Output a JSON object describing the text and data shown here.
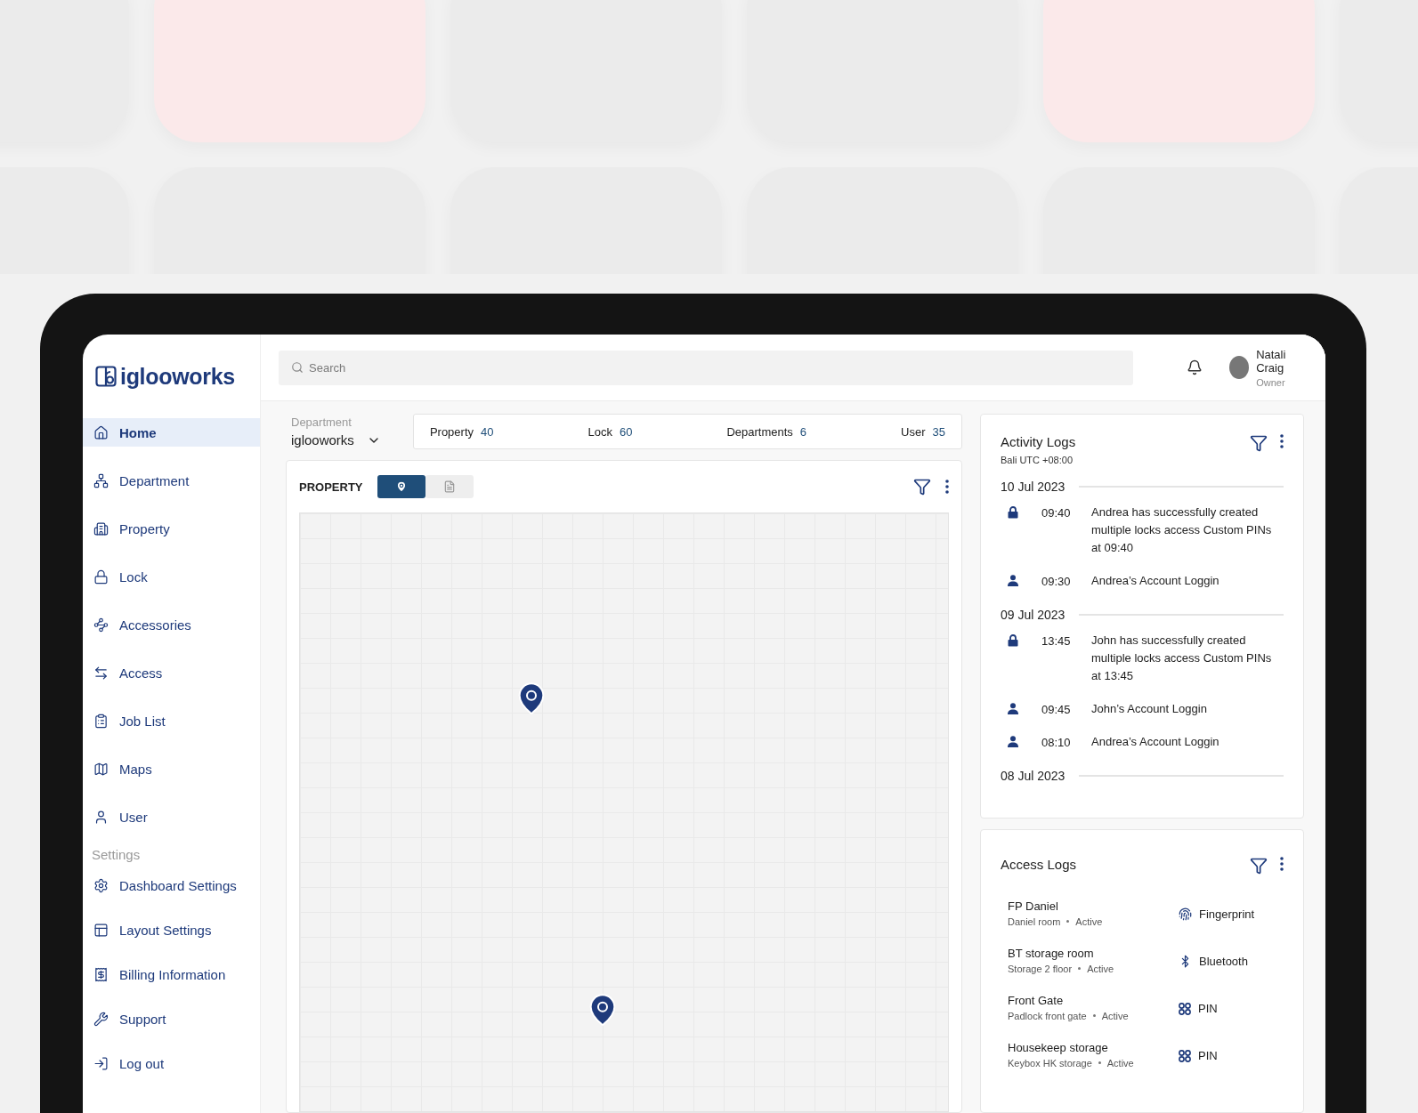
{
  "brand": "iglooworks",
  "search": {
    "placeholder": "Search"
  },
  "user": {
    "name": "Natali Craig",
    "role": "Owner"
  },
  "nav": [
    {
      "label": "Home",
      "selected": true
    },
    {
      "label": "Department",
      "selected": false
    },
    {
      "label": "Property",
      "selected": false
    },
    {
      "label": "Lock",
      "selected": false
    },
    {
      "label": "Accessories",
      "selected": false
    },
    {
      "label": "Access",
      "selected": false
    },
    {
      "label": "Job List",
      "selected": false
    },
    {
      "label": "Maps",
      "selected": false
    },
    {
      "label": "User",
      "selected": false
    }
  ],
  "settings": {
    "heading": "Settings",
    "items": [
      {
        "label": "Dashboard Settings",
        "selected": false
      },
      {
        "label": "Layout Settings",
        "selected": false
      },
      {
        "label": "Billing Information",
        "selected": false
      },
      {
        "label": "Support",
        "selected": false
      },
      {
        "label": "Log out",
        "selected": false
      }
    ]
  },
  "department": {
    "label": "Department",
    "value": "iglooworks"
  },
  "stats": [
    {
      "label": "Property",
      "value": "40"
    },
    {
      "label": "Lock",
      "value": "60"
    },
    {
      "label": "Departments",
      "value": "6"
    },
    {
      "label": "User",
      "value": "35"
    }
  ],
  "property": {
    "title": "PROPERTY",
    "views": [
      {
        "kind": "map",
        "selected": true
      },
      {
        "kind": "list",
        "selected": false
      }
    ]
  },
  "activity": {
    "title": "Activity Logs",
    "timezone": "Bali UTC +08:00",
    "groups": [
      {
        "date": "10 Jul 2023",
        "entries": [
          {
            "kind": "lock",
            "time": "09:40",
            "text": "Andrea has successfully created multiple locks access Custom PINs at 09:40"
          },
          {
            "kind": "user",
            "time": "09:30",
            "text": "Andrea’s Account Loggin"
          }
        ]
      },
      {
        "date": "09 Jul 2023",
        "entries": [
          {
            "kind": "lock",
            "time": "13:45",
            "text": "John has successfully created multiple locks access Custom PINs at 13:45"
          },
          {
            "kind": "user",
            "time": "09:45",
            "text": "John’s Account Loggin"
          },
          {
            "kind": "user",
            "time": "08:10",
            "text": "Andrea’s Account Loggin"
          }
        ]
      },
      {
        "date": "08 Jul 2023"
      }
    ]
  },
  "access": {
    "title": "Access Logs",
    "items": [
      {
        "name": "FP Daniel",
        "location": "Daniel room",
        "status": "Active",
        "kind": "fingerprint",
        "method": "Fingerprint"
      },
      {
        "name": "BT storage room",
        "location": "Storage 2 floor",
        "status": "Active",
        "kind": "bluetooth",
        "method": "Bluetooth"
      },
      {
        "name": "Front Gate",
        "location": "Padlock front gate",
        "status": "Active",
        "kind": "pin",
        "method": "PIN"
      },
      {
        "name": "Housekeep storage",
        "location": "Keybox HK storage",
        "status": "Active",
        "kind": "pin",
        "method": "PIN"
      }
    ]
  }
}
